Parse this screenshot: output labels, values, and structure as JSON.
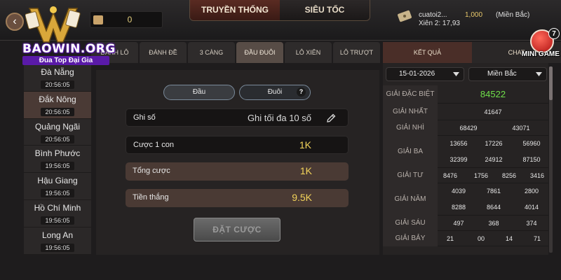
{
  "app": {
    "logo_brand": "BAOWIN.ORG",
    "logo_slogan": "Đua Top Đại Gia",
    "balance": "0"
  },
  "mode_tabs": [
    {
      "label": "TRUYỀN THỐNG",
      "active": true
    },
    {
      "label": "SIÊU TỐC",
      "active": false
    }
  ],
  "user_info": {
    "name": "cuatoi2...",
    "bet_amount": "1,000",
    "region": "(Miền Bắc)",
    "xien": "Xiên 2: 17,93"
  },
  "bet_tabs": [
    {
      "label": "ĐÁNH LÔ",
      "active": false
    },
    {
      "label": "ĐÁNH ĐỀ",
      "active": false
    },
    {
      "label": "3 CÀNG",
      "active": false
    },
    {
      "label": "ĐẦU ĐUÔI",
      "active": true
    },
    {
      "label": "LÔ XIÊN",
      "active": false
    },
    {
      "label": "LÔ TRƯỢT",
      "active": false
    }
  ],
  "provinces": [
    {
      "name": "Đà Nẵng",
      "time": "20:56:05",
      "active": false
    },
    {
      "name": "Đắk Nông",
      "time": "20:56:05",
      "active": true
    },
    {
      "name": "Quảng Ngãi",
      "time": "20:56:05",
      "active": false
    },
    {
      "name": "Bình Phước",
      "time": "19:56:05",
      "active": false
    },
    {
      "name": "Hậu Giang",
      "time": "19:56:05",
      "active": false
    },
    {
      "name": "Hồ Chí Minh",
      "time": "19:56:05",
      "active": false
    },
    {
      "name": "Long An",
      "time": "19:56:05",
      "active": false
    }
  ],
  "bet_panel": {
    "toggle_dau": "Đầu",
    "toggle_duoi": "Đuôi",
    "help": "?",
    "ghi_so_label": "Ghi số",
    "ghi_so_placeholder": "Ghi tối đa 10 số",
    "cuoc_label": "Cược 1 con",
    "cuoc_value": "1K",
    "tong_label": "Tổng cược",
    "tong_value": "1K",
    "thang_label": "Tiền thắng",
    "thang_value": "9.5K",
    "submit": "ĐẶT CƯỢC"
  },
  "right_tabs": [
    {
      "label": "KẾT QUẢ",
      "active": true
    },
    {
      "label": "CHAT",
      "active": false
    }
  ],
  "mini_game": {
    "label": "MINI GAME",
    "badge": "7"
  },
  "results": {
    "date": "15-01-2026",
    "region": "Miền Bắc",
    "rows": [
      {
        "label": "GIẢI ĐẶC BIỆT",
        "lines": [
          [
            "84522"
          ]
        ],
        "special": true
      },
      {
        "label": "GIẢI NHẤT",
        "lines": [
          [
            "41647"
          ]
        ]
      },
      {
        "label": "GIẢI NHÌ",
        "lines": [
          [
            "68429",
            "43071"
          ]
        ]
      },
      {
        "label": "GIẢI BA",
        "lines": [
          [
            "13656",
            "17226",
            "56960"
          ],
          [
            "32399",
            "24912",
            "87150"
          ]
        ]
      },
      {
        "label": "GIẢI TƯ",
        "lines": [
          [
            "8476",
            "1756",
            "8256",
            "3416"
          ]
        ]
      },
      {
        "label": "GIẢI NĂM",
        "lines": [
          [
            "4039",
            "7861",
            "2800"
          ],
          [
            "8288",
            "8644",
            "4014"
          ]
        ]
      },
      {
        "label": "GIẢI SÁU",
        "lines": [
          [
            "497",
            "368",
            "374"
          ]
        ]
      },
      {
        "label": "GIẢI BẢY",
        "lines": [
          [
            "21",
            "00",
            "14",
            "71"
          ]
        ]
      }
    ]
  }
}
